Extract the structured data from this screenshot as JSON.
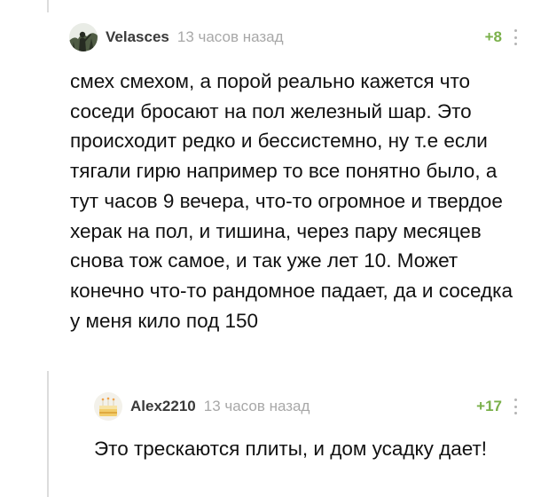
{
  "comments": [
    {
      "username": "Velasces",
      "time": "13 часов назад",
      "rating": "+8",
      "avatar_icon": "forest-figure-avatar",
      "body": "смех смехом, а порой реально кажется что соседи бросают на пол железный шар. Это происходит редко и бессистемно, ну т.е если тягали гирю например то все понятно было, а тут часов 9 вечера, что-то огромное и твердое херак на пол, и тишина, через пару месяцев снова тож самое, и так уже лет 10. Может конечно что-то рандомное падает, да и соседка у меня кило под 150"
    },
    {
      "username": "Alex2210",
      "time": "13 часов назад",
      "rating": "+17",
      "avatar_icon": "cake-avatar",
      "body": "Это трескаются плиты, и дом усадку дает!"
    }
  ],
  "colors": {
    "rating": "#7ab04a",
    "username": "#3a3a3a",
    "time": "#a8a8a8",
    "thread_line": "#dcdcdc"
  }
}
